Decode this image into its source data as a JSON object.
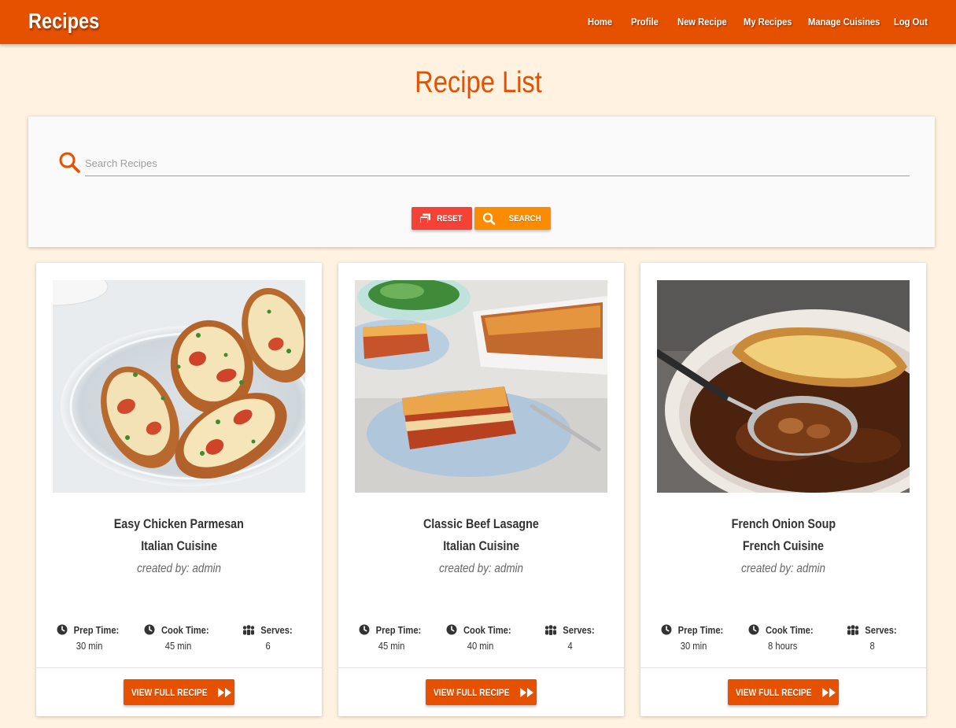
{
  "navbar": {
    "brand": "Recipes",
    "links": [
      "Home",
      "Profile",
      "New Recipe",
      "My Recipes",
      "Manage Cuisines",
      "Log Out"
    ]
  },
  "page_title": "Recipe List",
  "search": {
    "placeholder": "Search Recipes",
    "value": "",
    "reset_label": "RESET",
    "search_label": "SEARCH"
  },
  "stat_labels": {
    "prep": "Prep Time:",
    "cook": "Cook Time:",
    "serves": "Serves:"
  },
  "view_label": "VIEW FULL RECIPE",
  "recipes": [
    {
      "title": "Easy Chicken Parmesan",
      "cuisine": "Italian Cuisine",
      "author": "created by: admin",
      "prep": "30 min",
      "cook": "45 min",
      "serves": "6",
      "image": "chicken-parmesan-photo"
    },
    {
      "title": "Classic Beef Lasagne",
      "cuisine": "Italian Cuisine",
      "author": "created by: admin",
      "prep": "45 min",
      "cook": "40 min",
      "serves": "4",
      "image": "beef-lasagne-photo"
    },
    {
      "title": "French Onion Soup",
      "cuisine": "French Cuisine",
      "author": "created by: admin",
      "prep": "30 min",
      "cook": "8 hours",
      "serves": "8",
      "image": "french-onion-soup-photo"
    }
  ],
  "colors": {
    "primary": "#e65100",
    "background": "#fff2e0",
    "reset": "#f44336",
    "search": "#fb8c00"
  }
}
